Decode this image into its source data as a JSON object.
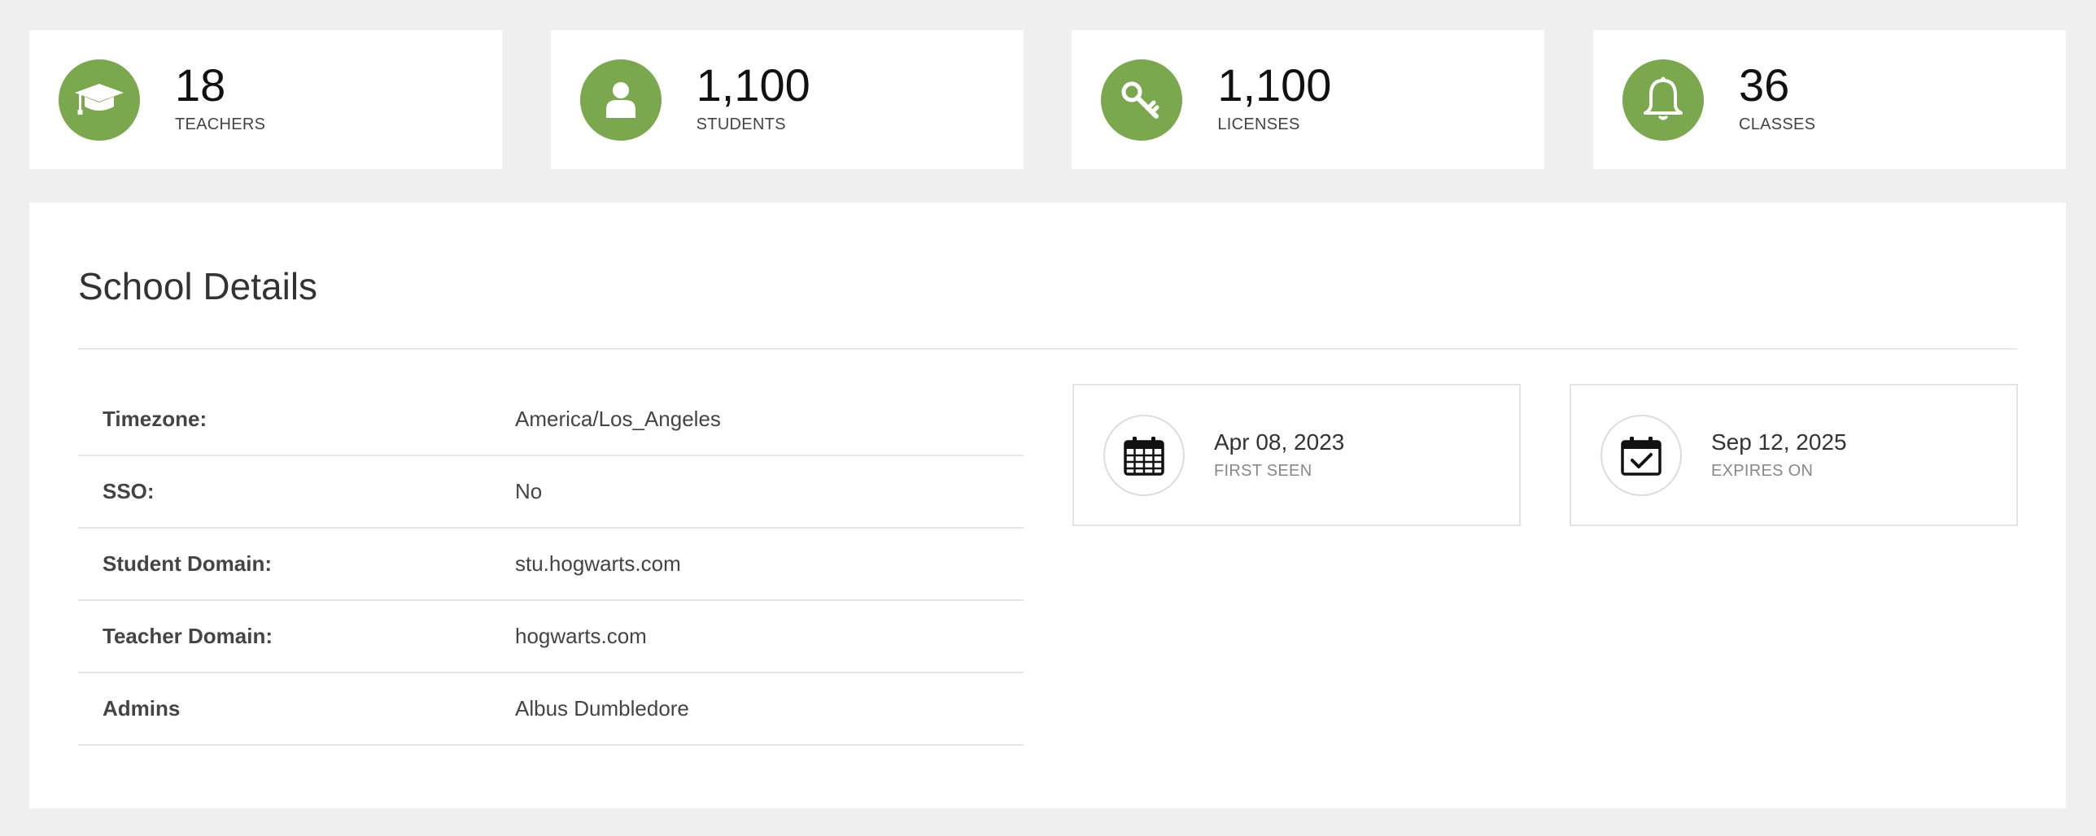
{
  "theme": {
    "accent": "#7ba74f",
    "page_bg": "#efefef",
    "card_bg": "#ffffff"
  },
  "stats": [
    {
      "value": "18",
      "label": "TEACHERS",
      "icon": "graduation-cap-icon"
    },
    {
      "value": "1,100",
      "label": "STUDENTS",
      "icon": "user-icon"
    },
    {
      "value": "1,100",
      "label": "LICENSES",
      "icon": "key-icon"
    },
    {
      "value": "36",
      "label": "CLASSES",
      "icon": "bell-icon"
    }
  ],
  "details": {
    "title": "School Details",
    "rows": [
      {
        "label": "Timezone:",
        "value": "America/Los_Angeles"
      },
      {
        "label": "SSO:",
        "value": "No"
      },
      {
        "label": "Student Domain:",
        "value": "stu.hogwarts.com"
      },
      {
        "label": "Teacher Domain:",
        "value": "hogwarts.com"
      },
      {
        "label": "Admins",
        "value": "Albus Dumbledore"
      }
    ],
    "first_seen": {
      "value": "Apr 08, 2023",
      "label": "FIRST SEEN",
      "icon": "calendar-icon"
    },
    "expires_on": {
      "value": "Sep 12, 2025",
      "label": "EXPIRES ON",
      "icon": "calendar-check-icon"
    }
  }
}
